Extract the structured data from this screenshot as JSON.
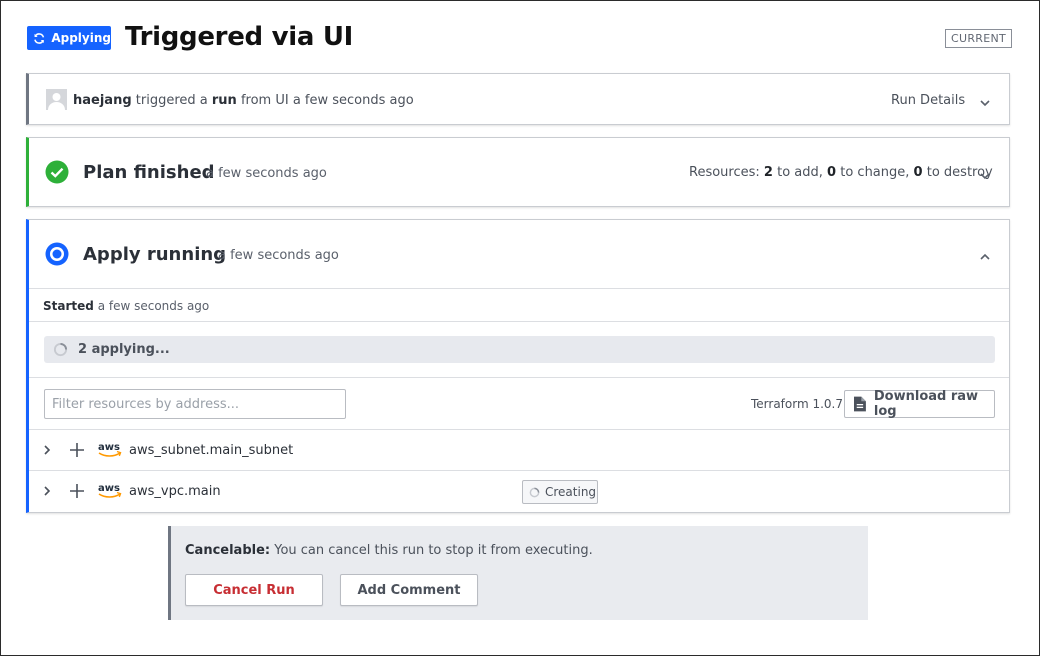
{
  "header": {
    "status_label": "Applying",
    "title": "Triggered via UI",
    "current_badge": "CURRENT",
    "status_color": "#1563ff"
  },
  "trigger": {
    "user": "haejang",
    "text_triggered": "triggered a",
    "run_word": "run",
    "text_from": "from UI a few seconds ago",
    "details_label": "Run Details"
  },
  "plan": {
    "title": "Plan finished",
    "time": "a few seconds ago",
    "resources_prefix": "Resources:",
    "add_count": "2",
    "add_text": "to add,",
    "change_count": "0",
    "change_text": "to change,",
    "destroy_count": "0",
    "destroy_text": "to destroy",
    "accent_color": "#2eb039"
  },
  "apply": {
    "title": "Apply running",
    "time": "a few seconds ago",
    "started_label": "Started",
    "started_time": "a few seconds ago",
    "applying_label": "2 applying...",
    "filter_placeholder": "Filter resources by address...",
    "terraform_version": "Terraform 1.0.7",
    "download_label": "Download raw log",
    "accent_color": "#1563ff",
    "resources": [
      {
        "address": "aws_subnet.main_subnet",
        "provider_icon": "aws-logo-icon",
        "status": ""
      },
      {
        "address": "aws_vpc.main",
        "provider_icon": "aws-logo-icon",
        "status": "Creating"
      }
    ]
  },
  "cancel_panel": {
    "bold_label": "Cancelable:",
    "text": "You can cancel this run to stop it from executing.",
    "cancel_button": "Cancel Run",
    "comment_button": "Add Comment",
    "danger_color": "#c72e33"
  }
}
